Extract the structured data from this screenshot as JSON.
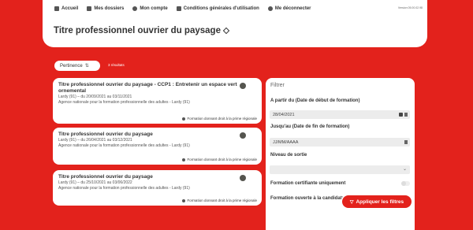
{
  "nav": {
    "items": [
      {
        "label": "Accueil",
        "icon": "home-icon"
      },
      {
        "label": "Mes dossiers",
        "icon": "folder-icon"
      },
      {
        "label": "Mon compte",
        "icon": "user-icon"
      },
      {
        "label": "Conditions générales d'utilisation",
        "icon": "document-icon"
      },
      {
        "label": "Me déconnecter",
        "icon": "power-icon"
      }
    ],
    "version": "Version 05.00.02.98"
  },
  "page": {
    "title": "Titre professionnel ouvrier du paysage"
  },
  "sort": {
    "label": "Pertinence",
    "results": "3 résultats"
  },
  "results": [
    {
      "title": "Titre professionnel ouvrier du paysage - CCP1 : Entretenir un espace vert ornemental",
      "dates": "Lardy (91) – du 20/09/2021 au 03/11/2021",
      "org": "Agence nationale pour la formation professionnelle des adultes - Lardy (91)",
      "badge": "Formation donnant droit à la prime régionale"
    },
    {
      "title": "Titre professionnel ouvrier du paysage",
      "dates": "Lardy (91) – du 26/04/2021 au 03/12/2021",
      "org": "Agence nationale pour la formation professionnelle des adultes - Lardy (91)",
      "badge": "Formation donnant droit à la prime régionale"
    },
    {
      "title": "Titre professionnel ouvrier du paysage",
      "dates": "Lardy (91) – du 25/10/2021 au 03/06/2022",
      "org": "Agence nationale pour la formation professionnelle des adultes - Lardy (91)",
      "badge": "Formation donnant droit à la prime régionale"
    }
  ],
  "filter": {
    "title": "Filtrer",
    "from_label": "A partir du (Date de début de formation)",
    "from_value": "28/04/2021",
    "to_label": "Jusqu'au (Date de fin de formation)",
    "to_placeholder": "JJ/MM/AAAA",
    "level_label": "Niveau de sortie",
    "certifying_label": "Formation certifiante uniquement",
    "open_label": "Formation ouverte à la candidature",
    "apply_label": "Appliquer les filtres"
  }
}
